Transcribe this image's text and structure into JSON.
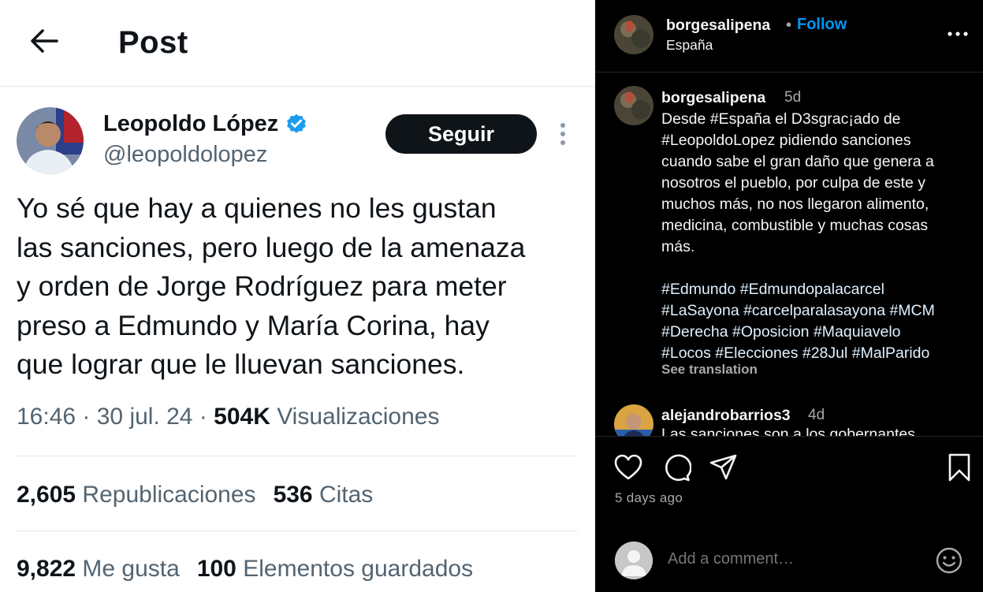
{
  "tweet": {
    "header_title": "Post",
    "author_name": "Leopoldo López",
    "author_handle": "@leopoldolopez",
    "follow_label": "Seguir",
    "text_lines": [
      "Yo sé que hay a quienes no les gustan",
      "las sanciones, pero luego de la amenaza",
      "y orden de Jorge Rodríguez para meter",
      "preso a Edmundo y María Corina, hay",
      "que lograr que le lluevan sanciones."
    ],
    "time": "16:46 · 30 jul. 24 · ",
    "views_count": "504K",
    "views_label": " Visualizaciones",
    "reposts_count": "2,605",
    "reposts_label": " Republicaciones",
    "quotes_count": "536",
    "quotes_label": " Citas",
    "likes_count": "9,822",
    "likes_label": " Me gusta",
    "bookmarks_count": "100",
    "bookmarks_label": " Elementos guardados",
    "verified_icon": "verified-badge-icon",
    "colors": {
      "verified": "#1d9bf0",
      "text": "#0f1419",
      "secondary": "#536471"
    }
  },
  "instagram": {
    "header": {
      "username": "borgesalipena",
      "separator": "•",
      "follow_label": "Follow",
      "location": "España"
    },
    "caption": {
      "username": "borgesalipena",
      "time": "5d",
      "lines": [
        "Desde #España el D3sgrac¡ado de",
        "#LeopoldoLopez pidiendo sanciones",
        "cuando sabe el gran daño que genera a",
        "nosotros el pueblo, por culpa de este y",
        "muchos más, no nos llegaron alimento,",
        "medicina, combustible y muchas cosas",
        "más.",
        "",
        "#Edmundo #Edmundopalacarcel",
        "#LaSayona #carcelparalasayona #MCM",
        "#Derecha #Oposicion #Maquiavelo",
        "#Locos #Elecciones #28Jul #MalParido"
      ],
      "see_translation": "See translation"
    },
    "reply": {
      "username": "alejandrobarrios3",
      "time": "4d",
      "text": "Las sanciones son a los gobernantes"
    },
    "date": "5 days ago",
    "comment_placeholder": "Add a comment…",
    "colors": {
      "follow": "#0095f6",
      "background": "#000000",
      "muted": "#a8a8a8"
    }
  }
}
